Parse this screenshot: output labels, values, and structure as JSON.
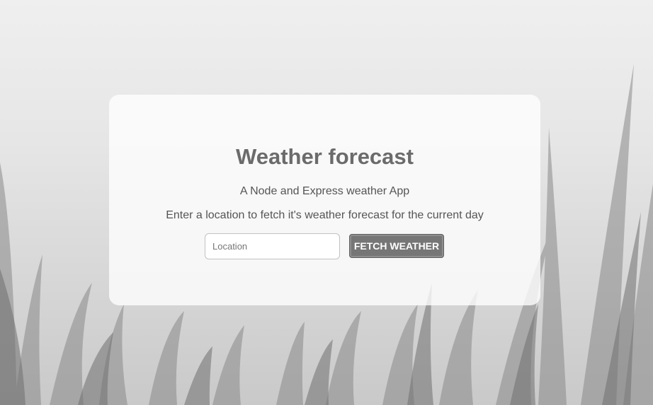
{
  "app": {
    "title": "Weather forecast",
    "subtitle": "A Node and Express weather App",
    "instructions": "Enter a location to fetch it's weather forecast for the current day"
  },
  "form": {
    "location_placeholder": "Location",
    "location_value": "",
    "fetch_button_label": "FETCH WEATHER"
  },
  "colors": {
    "page_background": "#efefef",
    "button_background": "#767676",
    "title_text": "#6b6b6b"
  }
}
